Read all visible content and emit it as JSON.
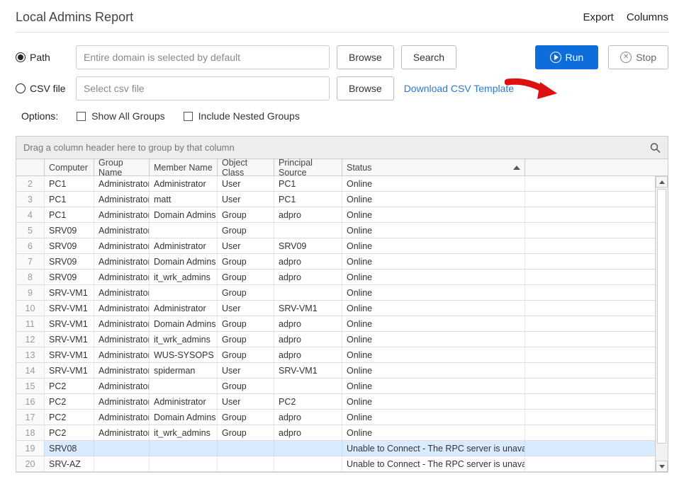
{
  "header": {
    "title": "Local Admins Report",
    "export": "Export",
    "columns": "Columns"
  },
  "form": {
    "path_label": "Path",
    "csv_label": "CSV file",
    "path_placeholder": "Entire domain is selected by default",
    "csv_placeholder": "Select csv file",
    "browse": "Browse",
    "search": "Search",
    "run": "Run",
    "stop": "Stop",
    "download_csv": "Download CSV Template"
  },
  "options": {
    "label": "Options:",
    "show_all": "Show All Groups",
    "nested": "Include Nested Groups"
  },
  "grid": {
    "group_hint": "Drag a column header here to group by that column",
    "headers": {
      "computer": "Computer",
      "group_name": "Group Name",
      "member_name": "Member Name",
      "object_class": "Object Class",
      "principal_source": "Principal Source",
      "status": "Status"
    },
    "status_online": "Online",
    "status_rpc": "Unable to Connect - The RPC server is unavailable.",
    "rows": [
      {
        "n": "2",
        "computer": "PC1",
        "group": "Administrators",
        "member": "Administrator",
        "objclass": "User",
        "src": "PC1",
        "status": "Online"
      },
      {
        "n": "3",
        "computer": "PC1",
        "group": "Administrators",
        "member": "matt",
        "objclass": "User",
        "src": "PC1",
        "status": "Online"
      },
      {
        "n": "4",
        "computer": "PC1",
        "group": "Administrators",
        "member": "Domain Admins",
        "objclass": "Group",
        "src": "adpro",
        "status": "Online"
      },
      {
        "n": "5",
        "computer": "SRV09",
        "group": "Administrators",
        "member": "",
        "objclass": "Group",
        "src": "",
        "status": "Online"
      },
      {
        "n": "6",
        "computer": "SRV09",
        "group": "Administrators",
        "member": "Administrator",
        "objclass": "User",
        "src": "SRV09",
        "status": "Online"
      },
      {
        "n": "7",
        "computer": "SRV09",
        "group": "Administrators",
        "member": "Domain Admins",
        "objclass": "Group",
        "src": "adpro",
        "status": "Online"
      },
      {
        "n": "8",
        "computer": "SRV09",
        "group": "Administrators",
        "member": "it_wrk_admins",
        "objclass": "Group",
        "src": "adpro",
        "status": "Online"
      },
      {
        "n": "9",
        "computer": "SRV-VM1",
        "group": "Administrators",
        "member": "",
        "objclass": "Group",
        "src": "",
        "status": "Online"
      },
      {
        "n": "10",
        "computer": "SRV-VM1",
        "group": "Administrators",
        "member": "Administrator",
        "objclass": "User",
        "src": "SRV-VM1",
        "status": "Online"
      },
      {
        "n": "11",
        "computer": "SRV-VM1",
        "group": "Administrators",
        "member": "Domain Admins",
        "objclass": "Group",
        "src": "adpro",
        "status": "Online"
      },
      {
        "n": "12",
        "computer": "SRV-VM1",
        "group": "Administrators",
        "member": "it_wrk_admins",
        "objclass": "Group",
        "src": "adpro",
        "status": "Online"
      },
      {
        "n": "13",
        "computer": "SRV-VM1",
        "group": "Administrators",
        "member": "WUS-SYSOPS",
        "objclass": "Group",
        "src": "adpro",
        "status": "Online"
      },
      {
        "n": "14",
        "computer": "SRV-VM1",
        "group": "Administrators",
        "member": "spiderman",
        "objclass": "User",
        "src": "SRV-VM1",
        "status": "Online"
      },
      {
        "n": "15",
        "computer": "PC2",
        "group": "Administrators",
        "member": "",
        "objclass": "Group",
        "src": "",
        "status": "Online"
      },
      {
        "n": "16",
        "computer": "PC2",
        "group": "Administrators",
        "member": "Administrator",
        "objclass": "User",
        "src": "PC2",
        "status": "Online"
      },
      {
        "n": "17",
        "computer": "PC2",
        "group": "Administrators",
        "member": "Domain Admins",
        "objclass": "Group",
        "src": "adpro",
        "status": "Online"
      },
      {
        "n": "18",
        "computer": "PC2",
        "group": "Administrators",
        "member": "it_wrk_admins",
        "objclass": "Group",
        "src": "adpro",
        "status": "Online"
      },
      {
        "n": "19",
        "computer": "SRV08",
        "group": "",
        "member": "",
        "objclass": "",
        "src": "",
        "status": "Unable to Connect - The RPC server is unavailable.",
        "hl": true
      },
      {
        "n": "20",
        "computer": "SRV-AZ",
        "group": "",
        "member": "",
        "objclass": "",
        "src": "",
        "status": "Unable to Connect - The RPC server is unavailable."
      }
    ]
  }
}
